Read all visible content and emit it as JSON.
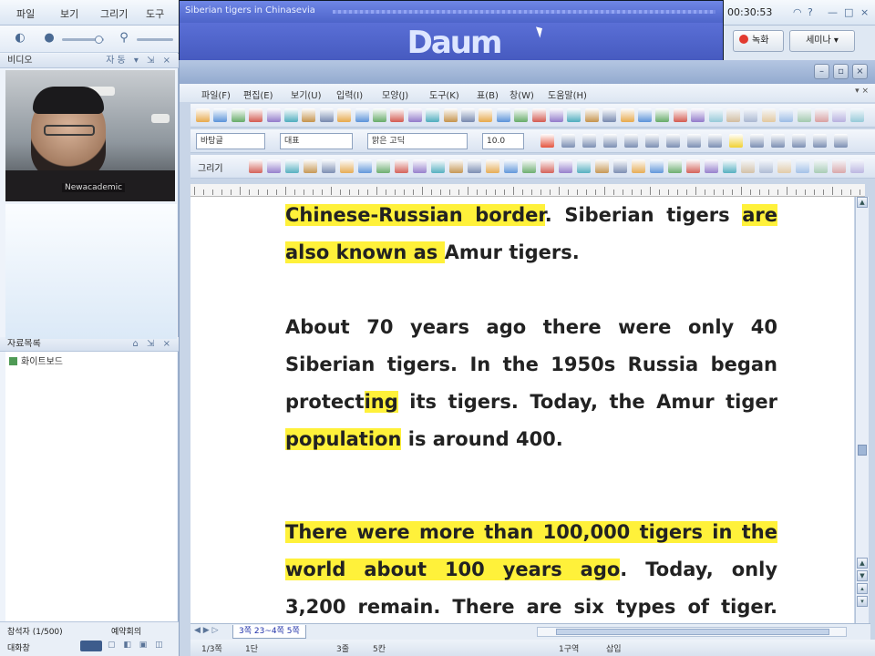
{
  "app_menu": {
    "items": [
      "파일",
      "보기",
      "그리기",
      "도구"
    ]
  },
  "left_panel": {
    "video_header": "비디오",
    "video_header_right": "자동",
    "webcam_caption": "Newacademic",
    "files_header": "자료목록",
    "file_items": [
      "화이트보드"
    ],
    "participants_label": "참석자 (1/500)",
    "participants_right": "예약회의",
    "chat_label": "대화창"
  },
  "player": {
    "title": "Siberian tigers in Chinasevia",
    "logo_text": "Daum",
    "seek_fraction": 0.36,
    "volume_fraction": 0.7
  },
  "top_right": {
    "timer": "00:30:53",
    "record_button": "녹화",
    "leave_button": "세미나"
  },
  "doc_window": {
    "menu": [
      "파일(F)",
      "편집(E)",
      "보기(U)",
      "입력(I)",
      "모양(J)",
      "도구(K)",
      "표(B)",
      "창(W)",
      "도움말(H)"
    ],
    "style_field": "바탕글",
    "font_lang_field": "대표",
    "font_field": "맑은 고딕",
    "size_field": "10.0",
    "draw_label": "그리기",
    "sheet_tab": "3쪽 23~4쪽 5쪽",
    "status": {
      "page": "1/3쪽",
      "section": "1단",
      "line": "3줄",
      "col": "5칸",
      "mode": "1구역",
      "insert": "삽입"
    }
  },
  "document": {
    "paragraphs": [
      {
        "lines": [
          [
            {
              "t": "Chinese-Russian border",
              "hl": true
            },
            {
              "t": ". Siberian tigers ",
              "hl": false
            },
            {
              "t": "are",
              "hl": true
            }
          ],
          [
            {
              "t": "also known as ",
              "hl": true
            },
            {
              "t": "Amur tigers.",
              "hl": false
            }
          ]
        ]
      },
      {
        "lines": [
          [
            {
              "t": "About 70 years ago there were only 40",
              "hl": false
            }
          ],
          [
            {
              "t": "Siberian tigers. In the 1950s Russia began",
              "hl": false
            }
          ],
          [
            {
              "t": "protect",
              "hl": false
            },
            {
              "t": "ing",
              "hl": true
            },
            {
              "t": " its tigers. Today, the Amur tiger",
              "hl": false
            }
          ],
          [
            {
              "t": "population",
              "hl": true
            },
            {
              "t": " is around 400.",
              "hl": false
            }
          ]
        ]
      },
      {
        "lines": [
          [
            {
              "t": "There were more than 100,000 tigers in the",
              "hl": true
            }
          ],
          [
            {
              "t": "world about 100 years ago",
              "hl": true
            },
            {
              "t": ". Today, only",
              "hl": false
            }
          ],
          [
            {
              "t": "3,200 remain. There are six types of tiger.",
              "hl": false
            }
          ]
        ]
      }
    ]
  },
  "colors": {
    "highlight": "#fff13a",
    "player_blue": "#4d64c9",
    "text": "#222222"
  }
}
